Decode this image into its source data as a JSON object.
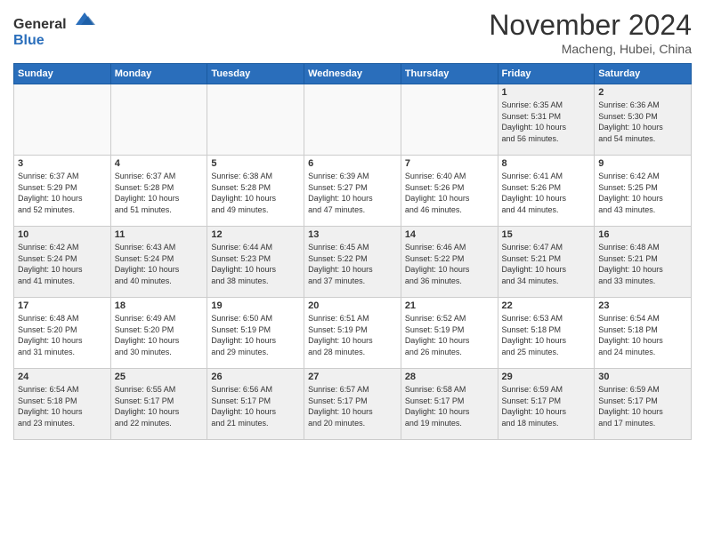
{
  "logo": {
    "general": "General",
    "blue": "Blue"
  },
  "header": {
    "month": "November 2024",
    "location": "Macheng, Hubei, China"
  },
  "days_of_week": [
    "Sunday",
    "Monday",
    "Tuesday",
    "Wednesday",
    "Thursday",
    "Friday",
    "Saturday"
  ],
  "weeks": [
    [
      {
        "day": "",
        "info": "",
        "empty": true
      },
      {
        "day": "",
        "info": "",
        "empty": true
      },
      {
        "day": "",
        "info": "",
        "empty": true
      },
      {
        "day": "",
        "info": "",
        "empty": true
      },
      {
        "day": "",
        "info": "",
        "empty": true
      },
      {
        "day": "1",
        "info": "Sunrise: 6:35 AM\nSunset: 5:31 PM\nDaylight: 10 hours\nand 56 minutes."
      },
      {
        "day": "2",
        "info": "Sunrise: 6:36 AM\nSunset: 5:30 PM\nDaylight: 10 hours\nand 54 minutes."
      }
    ],
    [
      {
        "day": "3",
        "info": "Sunrise: 6:37 AM\nSunset: 5:29 PM\nDaylight: 10 hours\nand 52 minutes."
      },
      {
        "day": "4",
        "info": "Sunrise: 6:37 AM\nSunset: 5:28 PM\nDaylight: 10 hours\nand 51 minutes."
      },
      {
        "day": "5",
        "info": "Sunrise: 6:38 AM\nSunset: 5:28 PM\nDaylight: 10 hours\nand 49 minutes."
      },
      {
        "day": "6",
        "info": "Sunrise: 6:39 AM\nSunset: 5:27 PM\nDaylight: 10 hours\nand 47 minutes."
      },
      {
        "day": "7",
        "info": "Sunrise: 6:40 AM\nSunset: 5:26 PM\nDaylight: 10 hours\nand 46 minutes."
      },
      {
        "day": "8",
        "info": "Sunrise: 6:41 AM\nSunset: 5:26 PM\nDaylight: 10 hours\nand 44 minutes."
      },
      {
        "day": "9",
        "info": "Sunrise: 6:42 AM\nSunset: 5:25 PM\nDaylight: 10 hours\nand 43 minutes."
      }
    ],
    [
      {
        "day": "10",
        "info": "Sunrise: 6:42 AM\nSunset: 5:24 PM\nDaylight: 10 hours\nand 41 minutes."
      },
      {
        "day": "11",
        "info": "Sunrise: 6:43 AM\nSunset: 5:24 PM\nDaylight: 10 hours\nand 40 minutes."
      },
      {
        "day": "12",
        "info": "Sunrise: 6:44 AM\nSunset: 5:23 PM\nDaylight: 10 hours\nand 38 minutes."
      },
      {
        "day": "13",
        "info": "Sunrise: 6:45 AM\nSunset: 5:22 PM\nDaylight: 10 hours\nand 37 minutes."
      },
      {
        "day": "14",
        "info": "Sunrise: 6:46 AM\nSunset: 5:22 PM\nDaylight: 10 hours\nand 36 minutes."
      },
      {
        "day": "15",
        "info": "Sunrise: 6:47 AM\nSunset: 5:21 PM\nDaylight: 10 hours\nand 34 minutes."
      },
      {
        "day": "16",
        "info": "Sunrise: 6:48 AM\nSunset: 5:21 PM\nDaylight: 10 hours\nand 33 minutes."
      }
    ],
    [
      {
        "day": "17",
        "info": "Sunrise: 6:48 AM\nSunset: 5:20 PM\nDaylight: 10 hours\nand 31 minutes."
      },
      {
        "day": "18",
        "info": "Sunrise: 6:49 AM\nSunset: 5:20 PM\nDaylight: 10 hours\nand 30 minutes."
      },
      {
        "day": "19",
        "info": "Sunrise: 6:50 AM\nSunset: 5:19 PM\nDaylight: 10 hours\nand 29 minutes."
      },
      {
        "day": "20",
        "info": "Sunrise: 6:51 AM\nSunset: 5:19 PM\nDaylight: 10 hours\nand 28 minutes."
      },
      {
        "day": "21",
        "info": "Sunrise: 6:52 AM\nSunset: 5:19 PM\nDaylight: 10 hours\nand 26 minutes."
      },
      {
        "day": "22",
        "info": "Sunrise: 6:53 AM\nSunset: 5:18 PM\nDaylight: 10 hours\nand 25 minutes."
      },
      {
        "day": "23",
        "info": "Sunrise: 6:54 AM\nSunset: 5:18 PM\nDaylight: 10 hours\nand 24 minutes."
      }
    ],
    [
      {
        "day": "24",
        "info": "Sunrise: 6:54 AM\nSunset: 5:18 PM\nDaylight: 10 hours\nand 23 minutes."
      },
      {
        "day": "25",
        "info": "Sunrise: 6:55 AM\nSunset: 5:17 PM\nDaylight: 10 hours\nand 22 minutes."
      },
      {
        "day": "26",
        "info": "Sunrise: 6:56 AM\nSunset: 5:17 PM\nDaylight: 10 hours\nand 21 minutes."
      },
      {
        "day": "27",
        "info": "Sunrise: 6:57 AM\nSunset: 5:17 PM\nDaylight: 10 hours\nand 20 minutes."
      },
      {
        "day": "28",
        "info": "Sunrise: 6:58 AM\nSunset: 5:17 PM\nDaylight: 10 hours\nand 19 minutes."
      },
      {
        "day": "29",
        "info": "Sunrise: 6:59 AM\nSunset: 5:17 PM\nDaylight: 10 hours\nand 18 minutes."
      },
      {
        "day": "30",
        "info": "Sunrise: 6:59 AM\nSunset: 5:17 PM\nDaylight: 10 hours\nand 17 minutes."
      }
    ]
  ]
}
